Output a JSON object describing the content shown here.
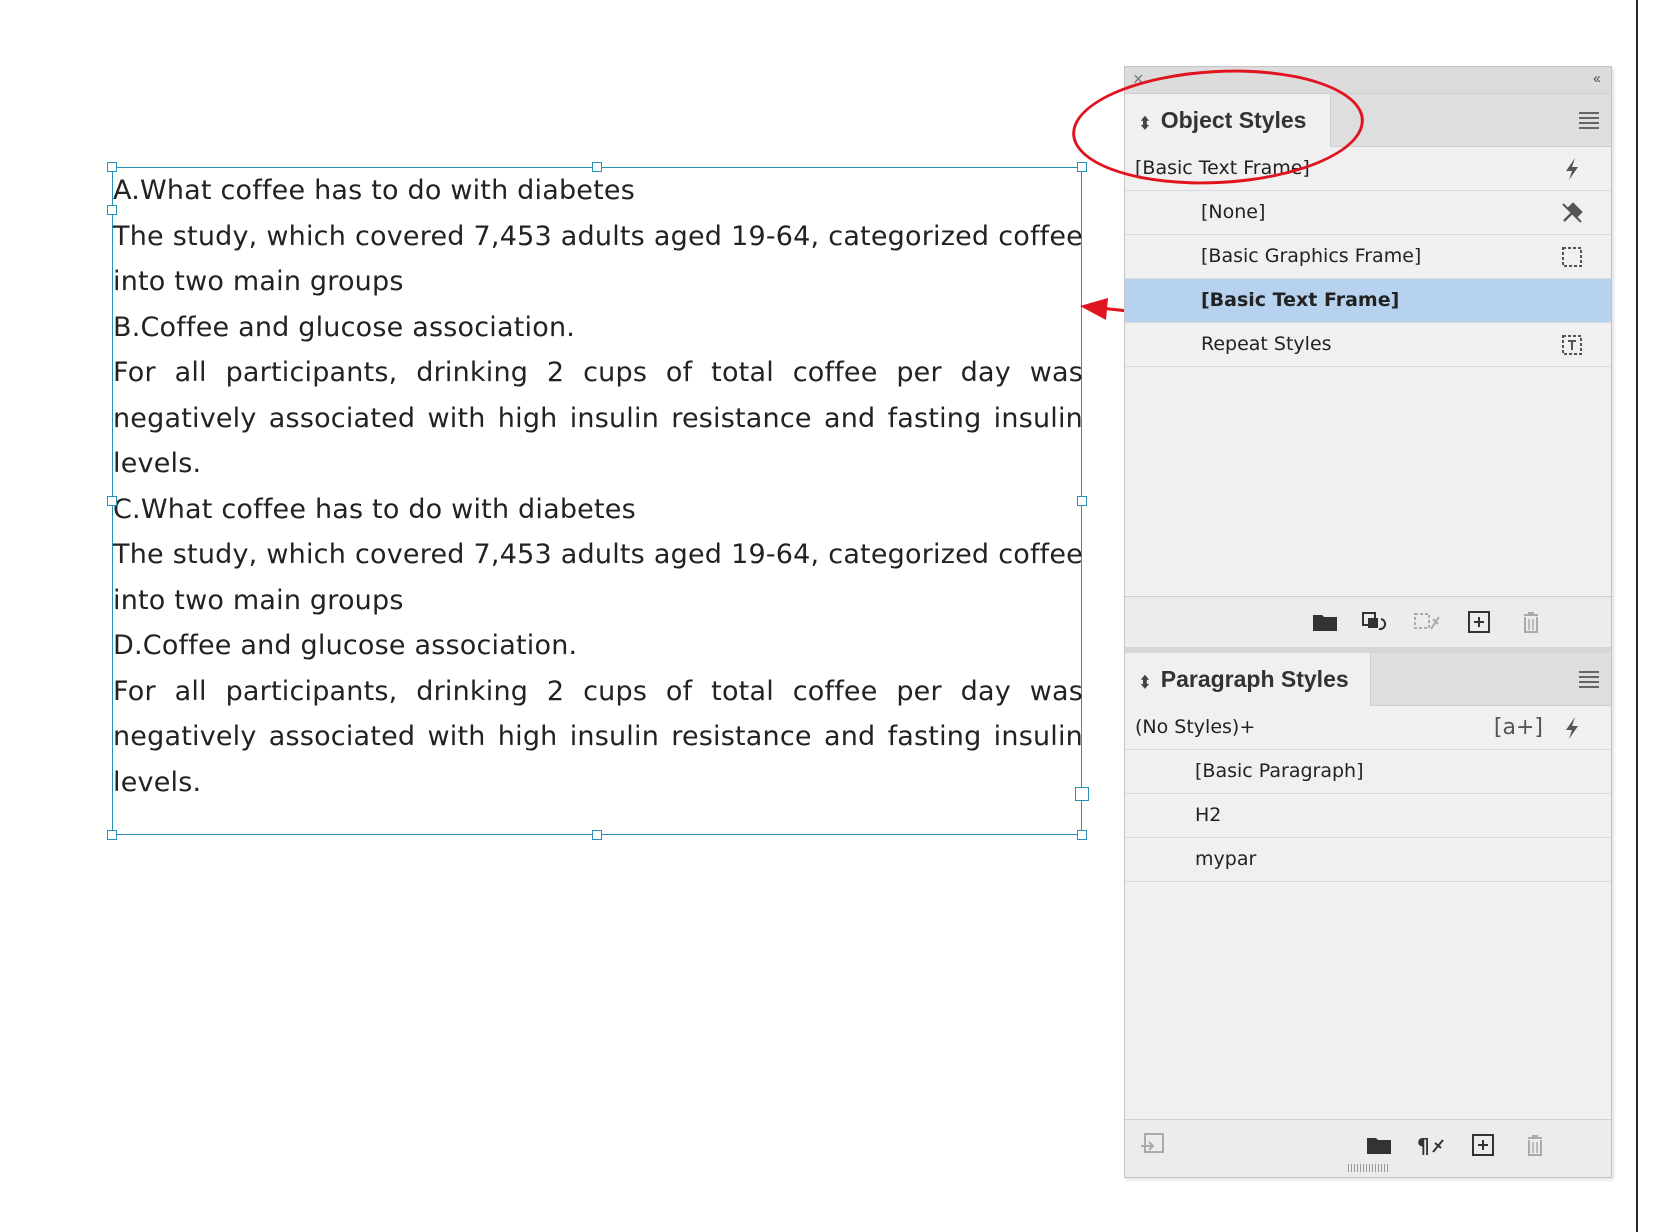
{
  "document": {
    "paragraphs": [
      "A.What coffee has to do with diabetes",
      "The study, which covered 7,453 adults aged 19-64, categorized coffee into two main groups",
      "B.Coffee and glucose association.",
      "For all participants, drinking 2 cups of total coffee per day was negatively associated with high insulin resistance and fasting insulin levels.",
      "C.What coffee has to do with diabetes",
      "The study, which covered 7,453 adults aged 19-64, categorized coffee into two main groups",
      "D.Coffee and glucose association.",
      "For all participants, drinking 2 cups of total coffee per day was negatively associated with high insulin resistance and fasting insulin levels."
    ]
  },
  "panel": {
    "collapse_glyph": "‹‹",
    "close_glyph": "×"
  },
  "object_styles": {
    "title": "Object Styles",
    "current": "[Basic Text Frame]",
    "items": [
      {
        "label": "[None]",
        "icon": "none-style-icon"
      },
      {
        "label": "[Basic Graphics Frame]",
        "icon": "graphics-frame-icon"
      },
      {
        "label": "[Basic Text Frame]",
        "icon": "",
        "selected": true
      },
      {
        "label": "Repeat Styles",
        "icon": "text-frame-icon"
      }
    ]
  },
  "paragraph_styles": {
    "title": "Paragraph Styles",
    "current": "(No Styles)+",
    "new_style_glyph": "[a+]",
    "items": [
      {
        "label": "[Basic Paragraph]"
      },
      {
        "label": "H2"
      },
      {
        "label": "mypar"
      }
    ]
  },
  "colors": {
    "frame_border": "#2a8fb5",
    "selection": "#b7d2ef",
    "callout_red": "#e0141e"
  }
}
